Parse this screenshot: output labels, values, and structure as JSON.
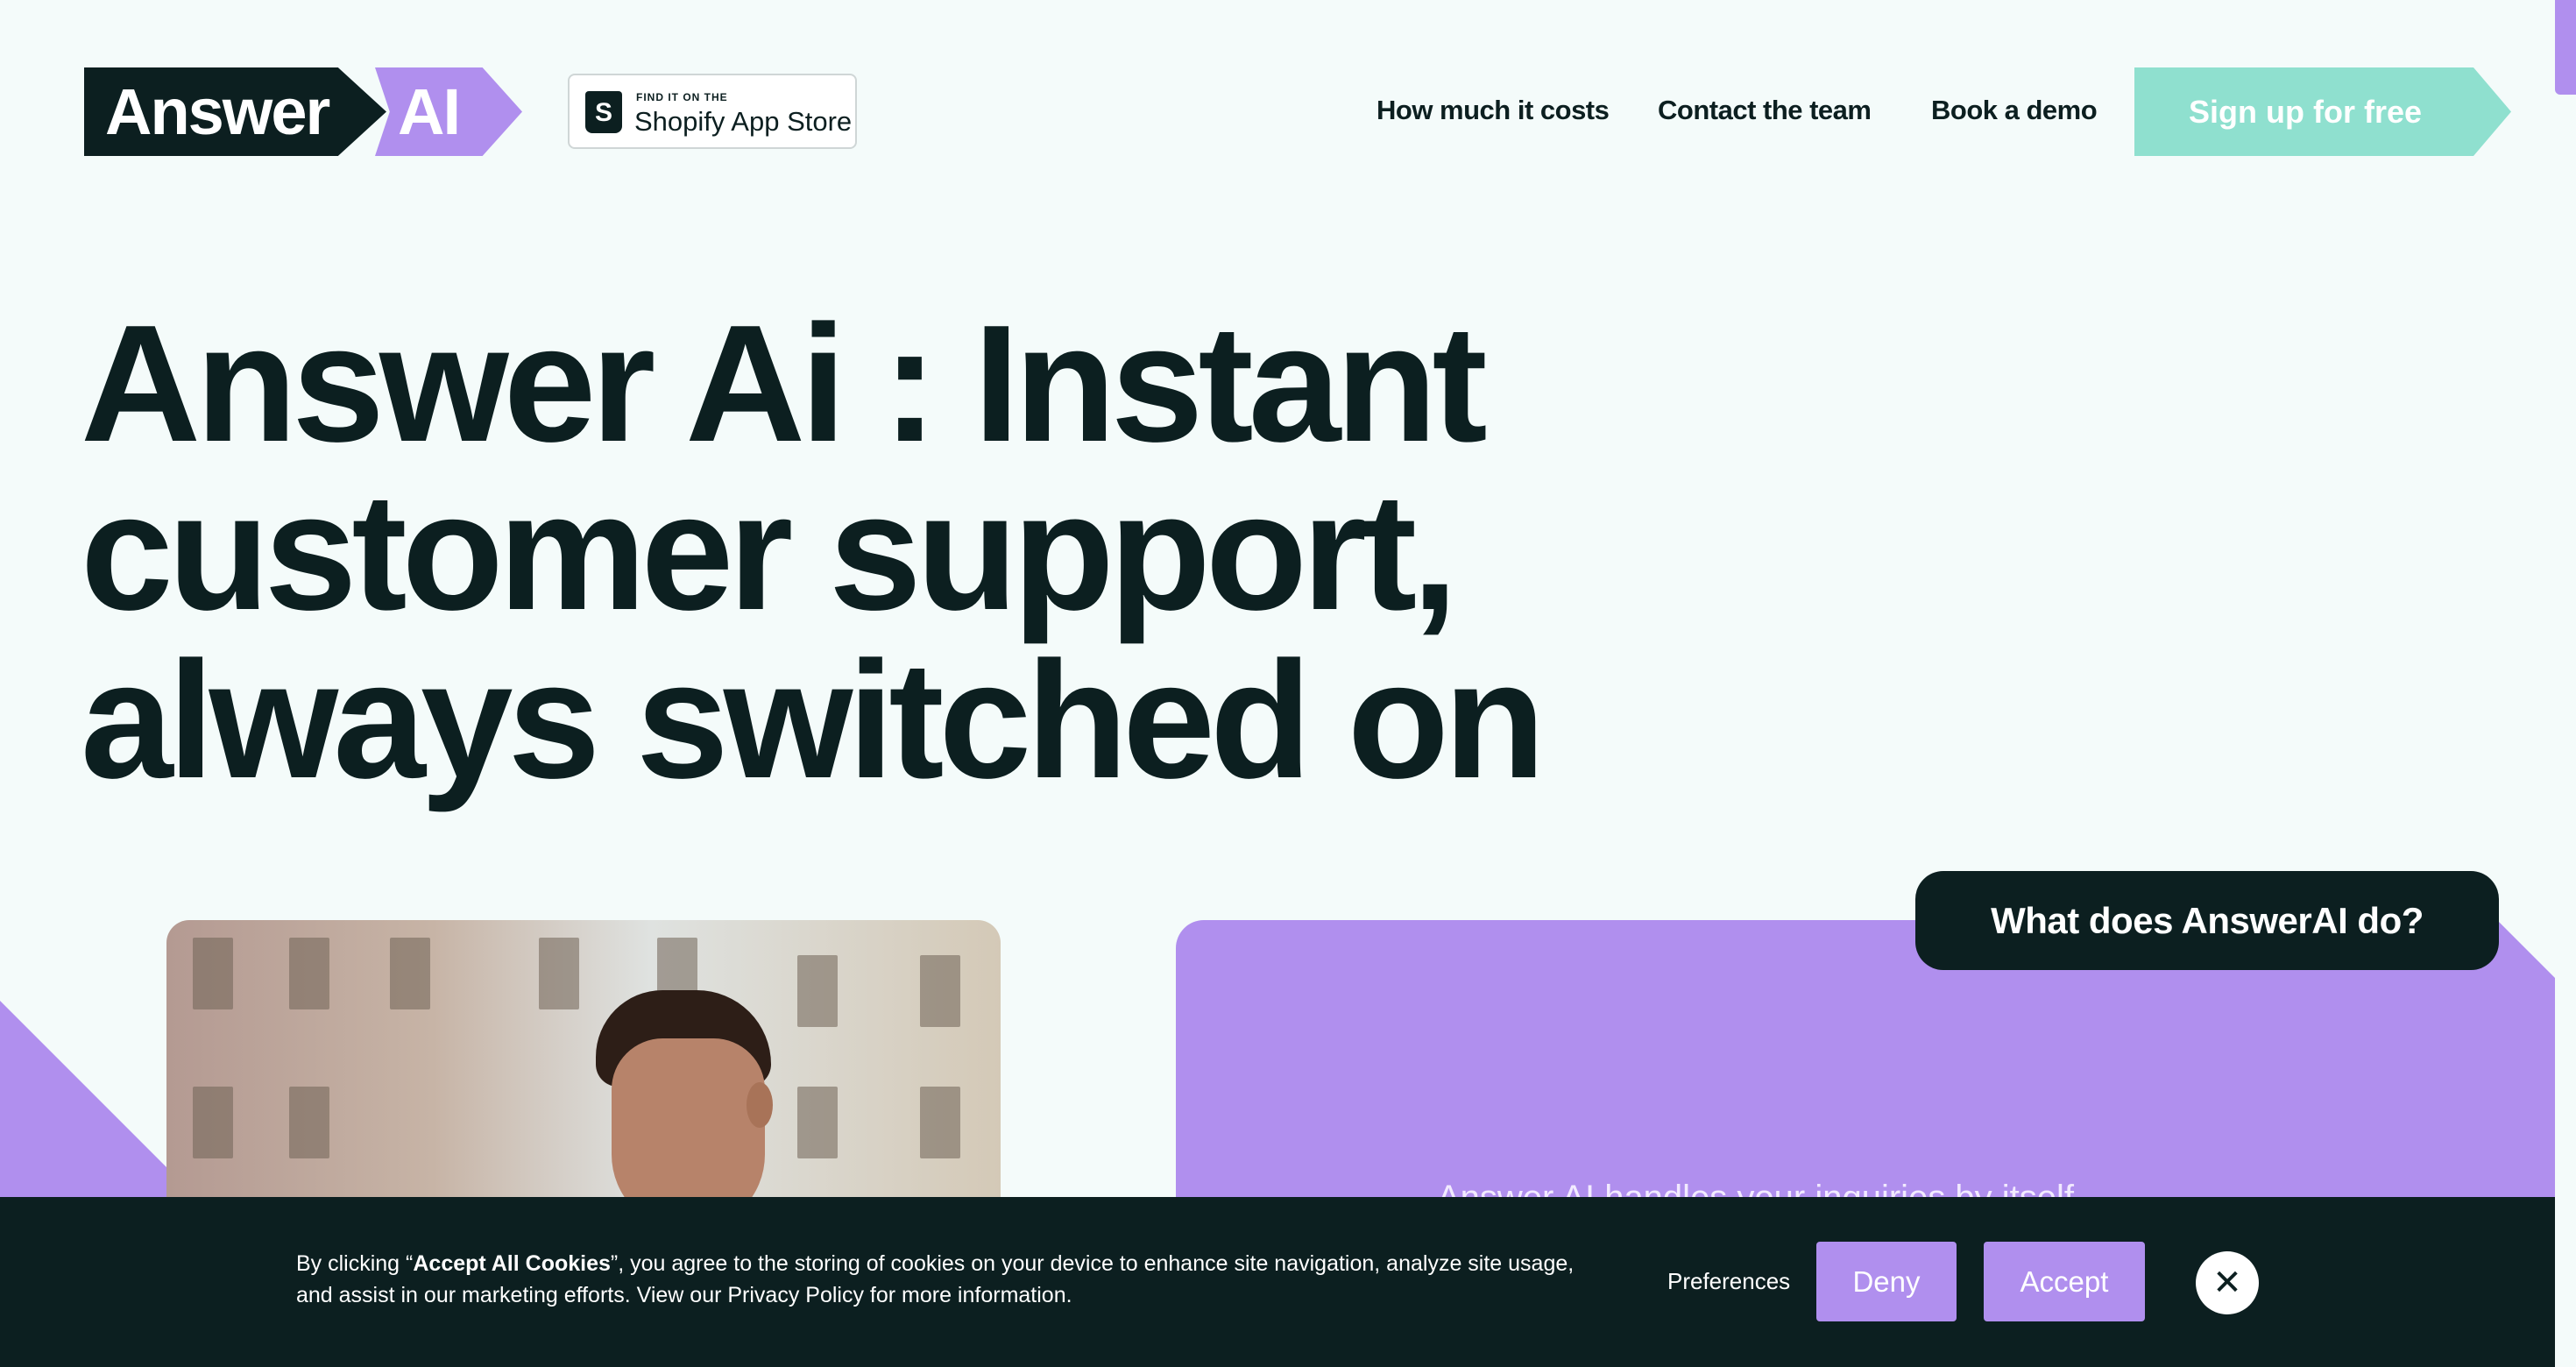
{
  "header": {
    "logo_primary": "Answer",
    "logo_accent": "AI",
    "shopify_badge": {
      "icon": "shopify-bag-icon",
      "small_text": "FIND IT ON THE",
      "large_text": "Shopify App Store"
    },
    "nav": [
      {
        "label": "How much it costs"
      },
      {
        "label": "Contact the team"
      },
      {
        "label": "Book a demo"
      }
    ],
    "cta_label": "Sign up for free"
  },
  "hero": {
    "title_lines": [
      "Answer Ai : Instant",
      "customer support,",
      "always switched on"
    ]
  },
  "feature_card": {
    "button_label": "What does AnswerAI do?",
    "partial_text": "Answer AI handles your inquiries by itself"
  },
  "cookie_banner": {
    "text_prefix": "By clicking “",
    "text_bold": "Accept All Cookies",
    "text_suffix": "”, you agree to the storing of cookies on your device to enhance site navigation, analyze site usage, and assist in our marketing efforts. View our Privacy Policy for more information.",
    "preferences_label": "Preferences",
    "deny_label": "Deny",
    "accept_label": "Accept",
    "close_icon": "close-icon",
    "close_glyph": "✕"
  },
  "colors": {
    "background": "#f4fbfa",
    "dark": "#0c1f20",
    "purple": "#b08fee",
    "mint": "#8fe0cf"
  }
}
